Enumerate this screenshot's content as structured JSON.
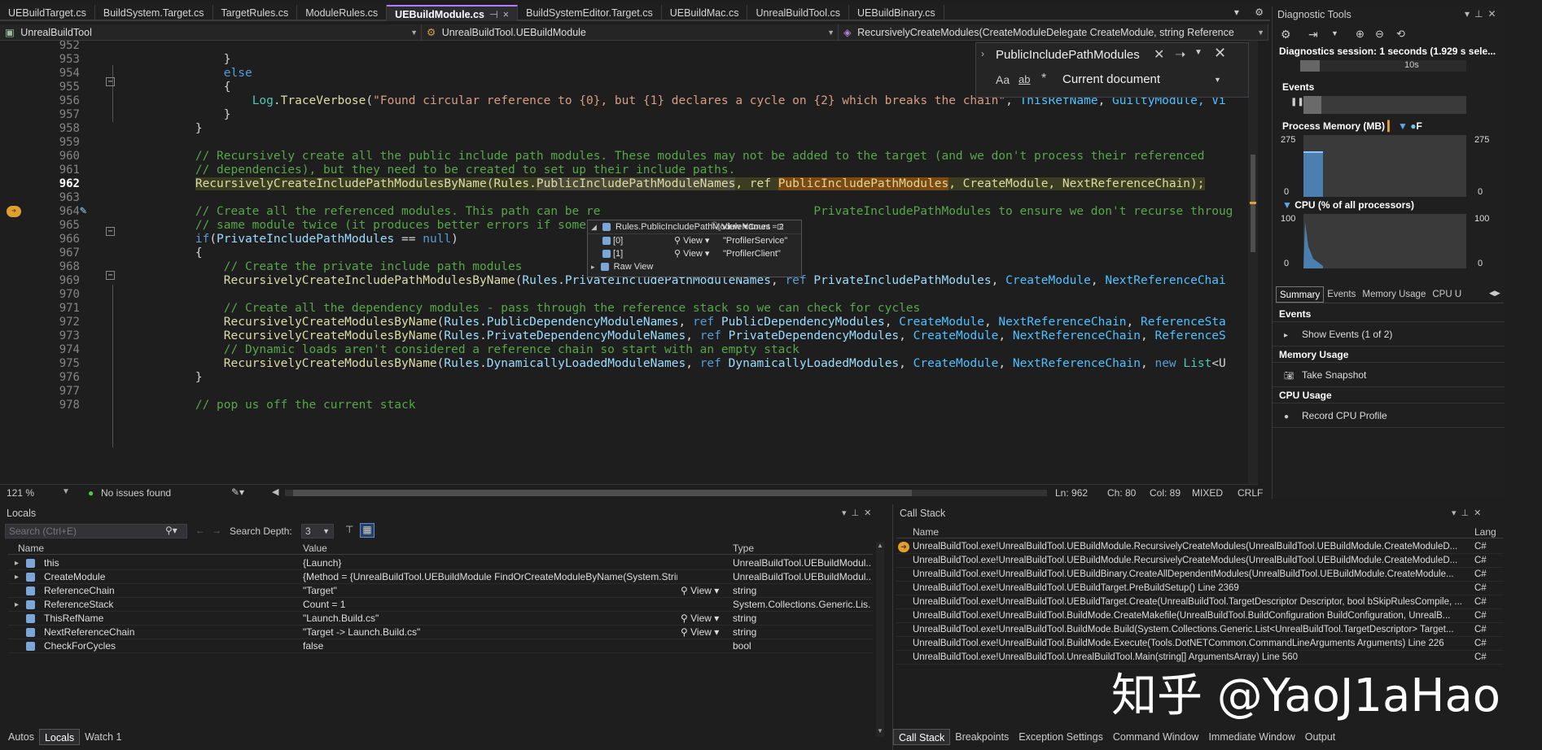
{
  "tabs": [
    {
      "label": "UEBuildTarget.cs"
    },
    {
      "label": "BuildSystem.Target.cs"
    },
    {
      "label": "TargetRules.cs"
    },
    {
      "label": "ModuleRules.cs"
    },
    {
      "label": "UEBuildModule.cs",
      "active": true
    },
    {
      "label": "BuildSystemEditor.Target.cs"
    },
    {
      "label": "UEBuildMac.cs"
    },
    {
      "label": "UnrealBuildTool.cs"
    },
    {
      "label": "UEBuildBinary.cs"
    }
  ],
  "tab_close": "×",
  "tab_controls": "▾ ⚙",
  "navbar": {
    "project": "UnrealBuildTool",
    "class": "UnrealBuildTool.UEBuildModule",
    "member": "RecursivelyCreateModules(CreateModuleDelegate CreateModule, string Reference"
  },
  "find": {
    "query": "PublicIncludePathModules",
    "scope": "Current document",
    "aa": "Aa",
    "ab": "ab",
    "ab_star": "*"
  },
  "editor": {
    "lines": [
      {
        "n": "952",
        "segs": []
      },
      {
        "n": "953",
        "segs": [
          {
            "t": "            }",
            "c": ""
          }
        ]
      },
      {
        "n": "954",
        "segs": [
          {
            "t": "            ",
            "c": ""
          },
          {
            "t": "else",
            "c": "kw"
          }
        ]
      },
      {
        "n": "955",
        "segs": [
          {
            "t": "            {",
            "c": ""
          }
        ]
      },
      {
        "n": "956",
        "segs": [
          {
            "t": "                ",
            "c": ""
          },
          {
            "t": "Log",
            "c": "pr"
          },
          {
            "t": ".",
            "c": ""
          },
          {
            "t": "TraceVerbose",
            "c": "fn"
          },
          {
            "t": "(",
            "c": ""
          },
          {
            "t": "\"Found circular reference to {0}, but {1} declares a cycle on {2} which breaks the chain\"",
            "c": "st"
          },
          {
            "t": ", ",
            "c": ""
          },
          {
            "t": "ThisRefName",
            "c": "ty"
          },
          {
            "t": ", ",
            "c": ""
          },
          {
            "t": "GuiltyModule",
            "c": "ty"
          },
          {
            "t": ", Vi",
            "c": "ty"
          }
        ]
      },
      {
        "n": "957",
        "segs": [
          {
            "t": "            }",
            "c": ""
          }
        ]
      },
      {
        "n": "958",
        "segs": [
          {
            "t": "        }",
            "c": ""
          }
        ]
      },
      {
        "n": "959",
        "segs": []
      },
      {
        "n": "960",
        "segs": [
          {
            "t": "        // Recursively create all the public include path modules. These modules may not be added to the target (and we don't process their referenced",
            "c": "cm"
          }
        ]
      },
      {
        "n": "961",
        "segs": [
          {
            "t": "        // dependencies), but they need to be created to set up their include paths.",
            "c": "cm"
          }
        ]
      },
      {
        "n": "962",
        "segs": [
          {
            "t": "        ",
            "c": ""
          },
          {
            "t": "RecursivelyCreateIncludePathModulesByName(Rules.",
            "c": "hl"
          },
          {
            "t": "PublicIncludePathModuleNames",
            "c": "hl2"
          },
          {
            "t": ", ref ",
            "c": "hl"
          },
          {
            "t": "PublicIncludePathModules",
            "c": "hl3"
          },
          {
            "t": ", CreateModule, NextReferenceChain);",
            "c": "hl"
          }
        ]
      },
      {
        "n": "963",
        "segs": []
      },
      {
        "n": "964",
        "segs": [
          {
            "t": "        // Create all the referenced modules. This path can be re",
            "c": "cm"
          },
          {
            "t": "                              ",
            "c": ""
          },
          {
            "t": "PrivateIncludePathModules to ensure we don't recurse throug",
            "c": "cm"
          }
        ]
      },
      {
        "n": "965",
        "segs": [
          {
            "t": "        // same module twice (it produces better errors if somet",
            "c": "cm"
          }
        ]
      },
      {
        "n": "966",
        "segs": [
          {
            "t": "        ",
            "c": ""
          },
          {
            "t": "if",
            "c": "kw"
          },
          {
            "t": "(",
            "c": ""
          },
          {
            "t": "PrivateIncludePathModules",
            "c": "mem"
          },
          {
            "t": " == ",
            "c": ""
          },
          {
            "t": "null",
            "c": "kw"
          },
          {
            "t": ")",
            "c": ""
          }
        ]
      },
      {
        "n": "967",
        "segs": [
          {
            "t": "        {",
            "c": ""
          }
        ]
      },
      {
        "n": "968",
        "segs": [
          {
            "t": "            // Create the private include path modules",
            "c": "cm"
          }
        ]
      },
      {
        "n": "969",
        "segs": [
          {
            "t": "            ",
            "c": ""
          },
          {
            "t": "RecursivelyCreateIncludePathModulesByName",
            "c": "fn"
          },
          {
            "t": "(",
            "c": ""
          },
          {
            "t": "Rules",
            "c": "mem"
          },
          {
            "t": ".",
            "c": ""
          },
          {
            "t": "PrivateIncludePathModuleNames",
            "c": "mem"
          },
          {
            "t": ", ",
            "c": ""
          },
          {
            "t": "ref",
            "c": "kw"
          },
          {
            "t": " ",
            "c": ""
          },
          {
            "t": "PrivateIncludePathModules",
            "c": "mem"
          },
          {
            "t": ", ",
            "c": ""
          },
          {
            "t": "CreateModule",
            "c": "ty"
          },
          {
            "t": ", ",
            "c": ""
          },
          {
            "t": "NextReferenceChai",
            "c": "ty"
          }
        ]
      },
      {
        "n": "970",
        "segs": []
      },
      {
        "n": "971",
        "segs": [
          {
            "t": "            // Create all the dependency modules - pass through the reference stack so we can check for cycles",
            "c": "cm"
          }
        ]
      },
      {
        "n": "972",
        "segs": [
          {
            "t": "            ",
            "c": ""
          },
          {
            "t": "RecursivelyCreateModulesByName",
            "c": "fn"
          },
          {
            "t": "(",
            "c": ""
          },
          {
            "t": "Rules",
            "c": "mem"
          },
          {
            "t": ".",
            "c": ""
          },
          {
            "t": "PublicDependencyModuleNames",
            "c": "mem"
          },
          {
            "t": ", ",
            "c": ""
          },
          {
            "t": "ref",
            "c": "kw"
          },
          {
            "t": " ",
            "c": ""
          },
          {
            "t": "PublicDependencyModules",
            "c": "mem"
          },
          {
            "t": ", ",
            "c": ""
          },
          {
            "t": "CreateModule",
            "c": "ty"
          },
          {
            "t": ", ",
            "c": ""
          },
          {
            "t": "NextReferenceChain",
            "c": "ty"
          },
          {
            "t": ", ",
            "c": ""
          },
          {
            "t": "ReferenceSta",
            "c": "ty"
          }
        ]
      },
      {
        "n": "973",
        "segs": [
          {
            "t": "            ",
            "c": ""
          },
          {
            "t": "RecursivelyCreateModulesByName",
            "c": "fn"
          },
          {
            "t": "(",
            "c": ""
          },
          {
            "t": "Rules",
            "c": "mem"
          },
          {
            "t": ".",
            "c": ""
          },
          {
            "t": "PrivateDependencyModuleNames",
            "c": "mem"
          },
          {
            "t": ", ",
            "c": ""
          },
          {
            "t": "ref",
            "c": "kw"
          },
          {
            "t": " ",
            "c": ""
          },
          {
            "t": "PrivateDependencyModules",
            "c": "mem"
          },
          {
            "t": ", ",
            "c": ""
          },
          {
            "t": "CreateModule",
            "c": "ty"
          },
          {
            "t": ", ",
            "c": ""
          },
          {
            "t": "NextReferenceChain",
            "c": "ty"
          },
          {
            "t": ", ",
            "c": ""
          },
          {
            "t": "ReferenceS",
            "c": "ty"
          }
        ]
      },
      {
        "n": "974",
        "segs": [
          {
            "t": "            // Dynamic loads aren't considered a reference chain so start with an empty stack",
            "c": "cm"
          }
        ]
      },
      {
        "n": "975",
        "segs": [
          {
            "t": "            ",
            "c": ""
          },
          {
            "t": "RecursivelyCreateModulesByName",
            "c": "fn"
          },
          {
            "t": "(",
            "c": ""
          },
          {
            "t": "Rules",
            "c": "mem"
          },
          {
            "t": ".",
            "c": ""
          },
          {
            "t": "DynamicallyLoadedModuleNames",
            "c": "mem"
          },
          {
            "t": ", ",
            "c": ""
          },
          {
            "t": "ref",
            "c": "kw"
          },
          {
            "t": " ",
            "c": ""
          },
          {
            "t": "DynamicallyLoadedModules",
            "c": "mem"
          },
          {
            "t": ", ",
            "c": ""
          },
          {
            "t": "CreateModule",
            "c": "ty"
          },
          {
            "t": ", ",
            "c": ""
          },
          {
            "t": "NextReferenceChain",
            "c": "ty"
          },
          {
            "t": ", ",
            "c": ""
          },
          {
            "t": "new",
            "c": "kw"
          },
          {
            "t": " ",
            "c": ""
          },
          {
            "t": "List",
            "c": "pr"
          },
          {
            "t": "<U",
            "c": ""
          }
        ]
      },
      {
        "n": "976",
        "segs": [
          {
            "t": "        }",
            "c": ""
          }
        ]
      },
      {
        "n": "977",
        "segs": []
      },
      {
        "n": "978",
        "segs": [
          {
            "t": "        // pop us off the current stack",
            "c": "cm"
          }
        ]
      }
    ]
  },
  "datatip": {
    "header": "Rules.PublicIncludePathModuleNames",
    "view": "View",
    "count": "Count = 2",
    "rows": [
      {
        "key": "[0]",
        "view": "View",
        "val": "\"ProfilerService\""
      },
      {
        "key": "[1]",
        "view": "View",
        "val": "\"ProfilerClient\""
      }
    ],
    "raw": "Raw View"
  },
  "status": {
    "zoom": "121 %",
    "issues": "No issues found",
    "ln": "Ln: 962",
    "ch": "Ch: 80",
    "col": "Col: 89",
    "mixed": "MIXED",
    "crlf": "CRLF"
  },
  "diag": {
    "title": "Diagnostic Tools",
    "session": "Diagnostics session: 1 seconds (1.929 s sele...",
    "tick": "10s",
    "events": "Events",
    "memory": "Process Memory (MB)",
    "mem_max": "275",
    "mem_min": "0",
    "cpu": "CPU (% of all processors)",
    "cpu_max": "100",
    "cpu_min": "0",
    "tabs": [
      "Summary",
      "Events",
      "Memory Usage",
      "CPU U"
    ],
    "sections": [
      {
        "head": "Events",
        "item": "Show Events (1 of 2)"
      },
      {
        "head": "Memory Usage",
        "item": "Take Snapshot"
      },
      {
        "head": "CPU Usage",
        "item": "Record CPU Profile"
      }
    ]
  },
  "locals": {
    "title": "Locals",
    "search_placeholder": "Search (Ctrl+E)",
    "depth_label": "Search Depth:",
    "depth": "3",
    "cols": [
      "Name",
      "Value",
      "Type"
    ],
    "rows": [
      {
        "name": "this",
        "value": "{Launch}",
        "type": "UnrealBuildTool.UEBuildModul...",
        "exp": true,
        "view": ""
      },
      {
        "name": "CreateModule",
        "value": "{Method = {UnrealBuildTool.UEBuildModule FindOrCreateModuleByName(System.String, System....",
        "type": "UnrealBuildTool.UEBuildModul...",
        "exp": true,
        "view": ""
      },
      {
        "name": "ReferenceChain",
        "value": "\"Target\"",
        "type": "string",
        "exp": false,
        "view": "View"
      },
      {
        "name": "ReferenceStack",
        "value": "Count = 1",
        "type": "System.Collections.Generic.Lis...",
        "exp": true,
        "view": ""
      },
      {
        "name": "ThisRefName",
        "value": "\"Launch.Build.cs\"",
        "type": "string",
        "exp": false,
        "view": "View"
      },
      {
        "name": "NextReferenceChain",
        "value": "\"Target -> Launch.Build.cs\"",
        "type": "string",
        "exp": false,
        "view": "View"
      },
      {
        "name": "CheckForCycles",
        "value": "false",
        "type": "bool",
        "exp": false,
        "view": ""
      }
    ],
    "bottom_tabs": [
      "Autos",
      "Locals",
      "Watch 1"
    ]
  },
  "callstack": {
    "title": "Call Stack",
    "cols": [
      "Name",
      "Lang"
    ],
    "rows": [
      {
        "name": "UnrealBuildTool.exe!UnrealBuildTool.UEBuildModule.RecursivelyCreateModules(UnrealBuildTool.UEBuildModule.CreateModuleD...",
        "lang": "C#"
      },
      {
        "name": "UnrealBuildTool.exe!UnrealBuildTool.UEBuildModule.RecursivelyCreateModules(UnrealBuildTool.UEBuildModule.CreateModuleD...",
        "lang": "C#"
      },
      {
        "name": "UnrealBuildTool.exe!UnrealBuildTool.UEBuildBinary.CreateAllDependentModules(UnrealBuildTool.UEBuildModule.CreateModule...",
        "lang": "C#"
      },
      {
        "name": "UnrealBuildTool.exe!UnrealBuildTool.UEBuildTarget.PreBuildSetup() Line 2369",
        "lang": "C#"
      },
      {
        "name": "UnrealBuildTool.exe!UnrealBuildTool.UEBuildTarget.Create(UnrealBuildTool.TargetDescriptor Descriptor, bool bSkipRulesCompile, ...",
        "lang": "C#"
      },
      {
        "name": "UnrealBuildTool.exe!UnrealBuildTool.BuildMode.CreateMakefile(UnrealBuildTool.BuildConfiguration BuildConfiguration, UnrealB...",
        "lang": "C#"
      },
      {
        "name": "UnrealBuildTool.exe!UnrealBuildTool.BuildMode.Build(System.Collections.Generic.List<UnrealBuildTool.TargetDescriptor> Target...",
        "lang": "C#"
      },
      {
        "name": "UnrealBuildTool.exe!UnrealBuildTool.BuildMode.Execute(Tools.DotNETCommon.CommandLineArguments Arguments) Line 226",
        "lang": "C#"
      },
      {
        "name": "UnrealBuildTool.exe!UnrealBuildTool.UnrealBuildTool.Main(string[] ArgumentsArray) Line 560",
        "lang": "C#"
      }
    ],
    "bottom_tabs": [
      "Call Stack",
      "Breakpoints",
      "Exception Settings",
      "Command Window",
      "Immediate Window",
      "Output"
    ]
  },
  "watermark": "知乎 @YaoJ1aHao",
  "colors": {
    "accent": "#b37dff",
    "highlight": "#3a3d1f",
    "keyword": "#569cd6",
    "comment": "#57a64a"
  }
}
